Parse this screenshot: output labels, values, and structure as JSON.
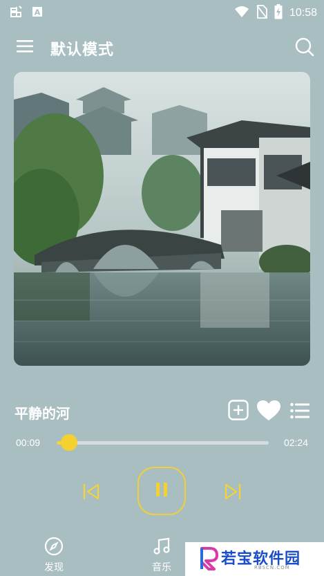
{
  "status_bar": {
    "time": "10:58",
    "left_icons": [
      "bug-icon",
      "a-box-icon"
    ],
    "right_icons": [
      "wifi-icon",
      "no-sim-icon",
      "battery-charging-icon"
    ]
  },
  "header": {
    "title": "默认模式",
    "menu_icon": "hamburger-menu-icon",
    "search_icon": "search-icon"
  },
  "cover": {
    "description_icon": "album-cover-image"
  },
  "song": {
    "title": "平静的河",
    "actions": [
      "add-icon",
      "heart-icon",
      "playlist-icon"
    ]
  },
  "progress": {
    "current": "00:09",
    "total": "02:24",
    "fraction": 0.06
  },
  "controls": {
    "prev": "skip-previous-icon",
    "play_state": "pause-icon",
    "next": "skip-next-icon"
  },
  "bottom_nav": {
    "items": [
      {
        "label": "发现",
        "icon": "compass-icon"
      },
      {
        "label": "音乐",
        "icon": "music-note-icon"
      }
    ]
  },
  "watermark": {
    "text": "若宝软件园",
    "sub": "RBSCN.COM"
  },
  "colors": {
    "background": "#a9bec1",
    "accent": "#f4d12e",
    "track": "#d3dde0"
  }
}
